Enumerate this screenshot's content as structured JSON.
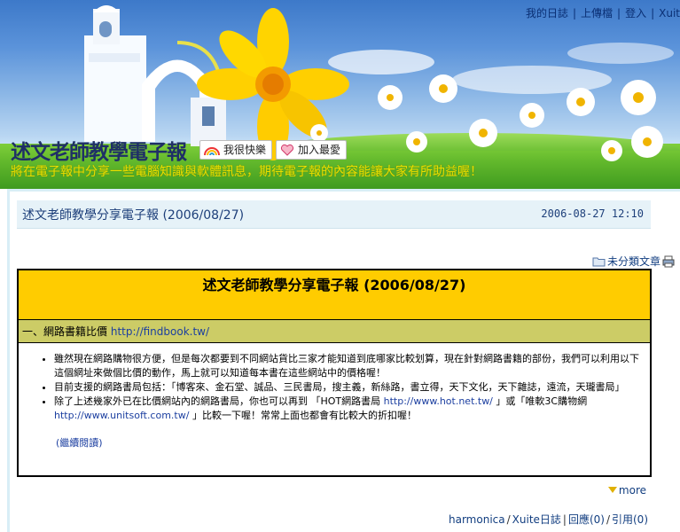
{
  "nav": {
    "items": [
      "我的日誌",
      "上傳檔",
      "登入",
      "Xuit"
    ]
  },
  "blog": {
    "title": "述文老師教學電子報",
    "subtitle": "將在電子報中分享一些電腦知識與軟體訊息，期待電子報的內容能讓大家有所助益喔！",
    "happy_label": "我很快樂",
    "fav_label": "加入最愛"
  },
  "post": {
    "title": "述文老師教學分享電子報 (2006/08/27)",
    "date": "2006-08-27 12:10",
    "category_label": "未分類文章",
    "box_title": "述文老師教學分享電子報 (2006/08/27)",
    "section_label": "一、網路書籍比價",
    "section_link": "http://findbook.tw/",
    "bullets": [
      "雖然現在網路購物很方便，但是每次都要到不同網站貨比三家才能知道到底哪家比較划算，現在針對網路書籍的部份，我們可以利用以下這個網址來做個比價的動作，馬上就可以知道每本書在這些網站中的價格喔！",
      "目前支援的網路書局包括：「博客來、金石堂、誠品、三民書局，搜主義，新絲路，書立得，天下文化，天下雜誌，遠流，天瓏書局」"
    ],
    "bullet3_a": "除了上述幾家外已在比價網站內的網路書局，你也可以再到 「HOT網路書局 ",
    "bullet3_link1": "http://www.hot.net.tw/",
    "bullet3_b": " 」或「唯軟3C購物網 ",
    "bullet3_link2": "http://www.unitsoft.com.tw/",
    "bullet3_c": " 」比較一下喔！常常上面也都會有比較大的折扣喔！",
    "read_more": "(繼續閱讀)",
    "more_label": "more",
    "footer": {
      "author": "harmonica",
      "xuite": "Xuite日誌",
      "replies": "回應(0)",
      "trackbacks": "引用(0)"
    }
  },
  "colors": {
    "box_title_bg": "#ffcc00",
    "section_bg": "#cccc66",
    "post_header_bg": "#e6f2f8",
    "link": "#1c3fa0"
  }
}
